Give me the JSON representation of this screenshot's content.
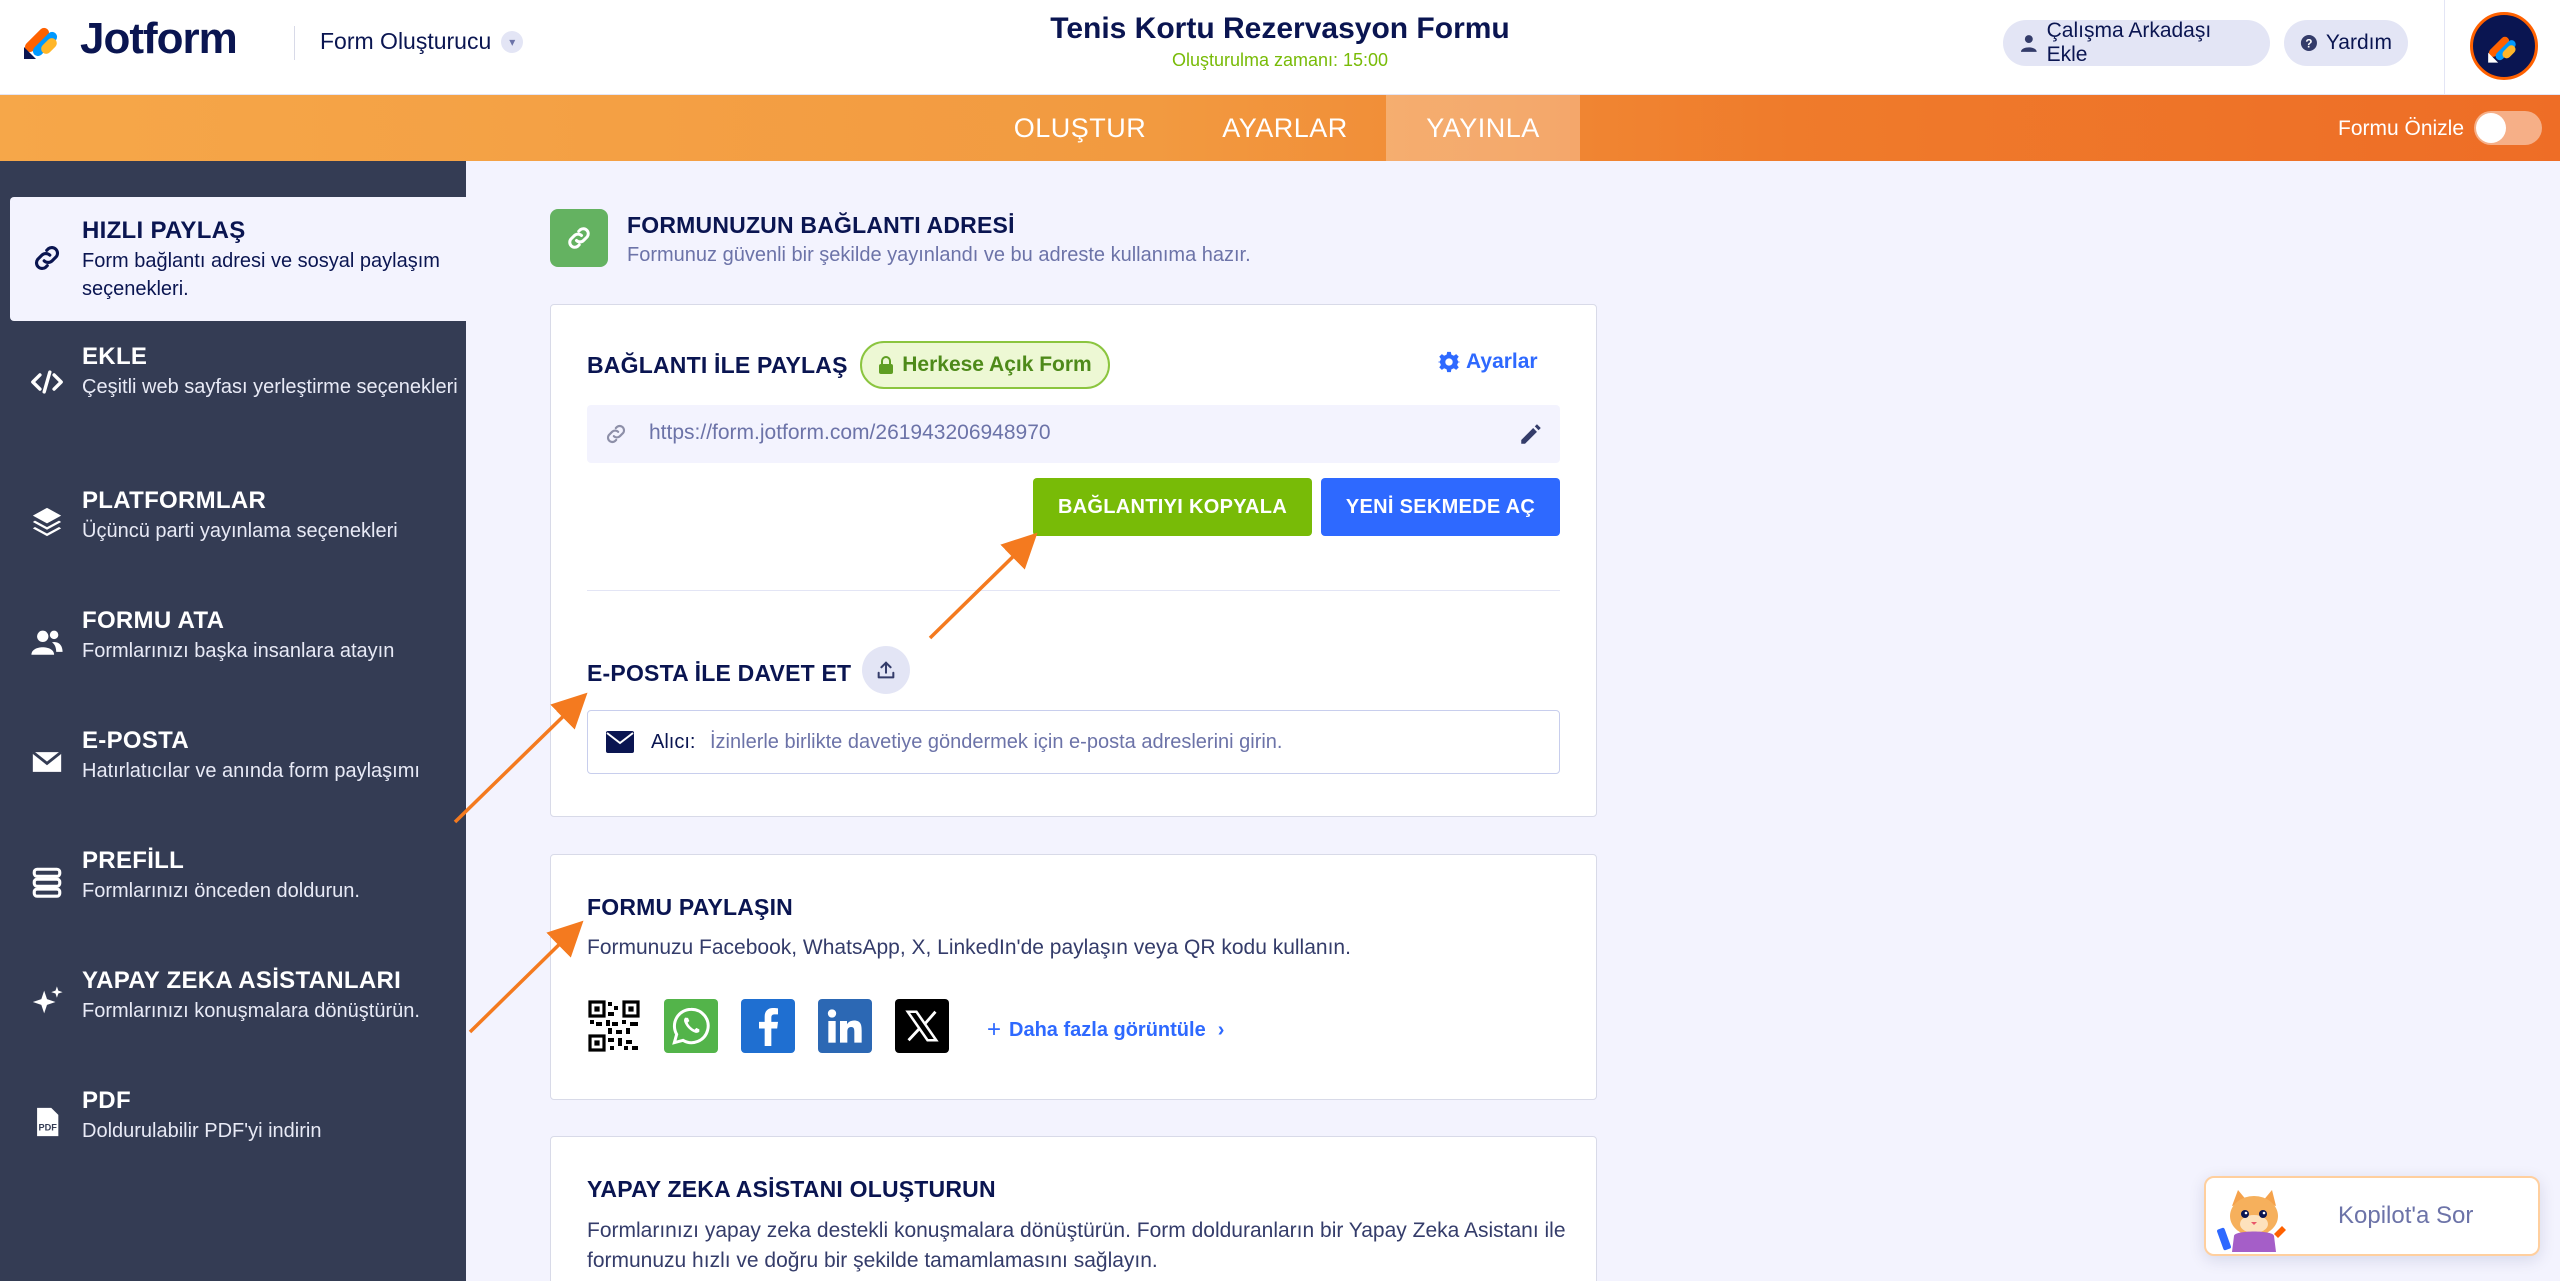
{
  "header": {
    "logo_text": "Jotform",
    "builder_label": "Form Oluşturucu",
    "form_title": "Tenis Kortu Rezervasyon Formu",
    "created_at": "Oluşturulma zamanı: 15:00",
    "add_teammate": "Çalışma Arkadaşı Ekle",
    "help": "Yardım"
  },
  "nav": {
    "tabs": [
      {
        "label": "OLUŞTUR",
        "active": false
      },
      {
        "label": "AYARLAR",
        "active": false
      },
      {
        "label": "YAYINLA",
        "active": true
      }
    ],
    "preview_label": "Formu Önizle",
    "preview_on": false
  },
  "sidebar": {
    "items": [
      {
        "title": "HIZLI PAYLAŞ",
        "desc": "Form bağlantı adresi ve sosyal paylaşım seçenekleri.",
        "icon": "link-icon",
        "active": true
      },
      {
        "title": "EKLE",
        "desc": "Çeşitli web sayfası yerleştirme seçenekleri",
        "icon": "code-icon",
        "active": false
      },
      {
        "title": "PLATFORMLAR",
        "desc": "Üçüncü parti yayınlama seçenekleri",
        "icon": "layers-icon",
        "active": false
      },
      {
        "title": "FORMU ATA",
        "desc": "Formlarınızı başka insanlara atayın",
        "icon": "users-icon",
        "active": false
      },
      {
        "title": "E-POSTA",
        "desc": "Hatırlatıcılar ve anında form paylaşımı",
        "icon": "envelope-icon",
        "active": false
      },
      {
        "title": "PREFİLL",
        "desc": "Formlarınızı önceden doldurun.",
        "icon": "prefill-icon",
        "active": false
      },
      {
        "title": "YAPAY ZEKA ASİSTANLARI",
        "desc": "Formlarınızı konuşmalara dönüştürün.",
        "icon": "sparkle-icon",
        "active": false
      },
      {
        "title": "PDF",
        "desc": "Doldurulabilir PDF'yi indirin",
        "icon": "pdf-icon",
        "active": false
      }
    ]
  },
  "link_section": {
    "title": "FORMUNUZUN BAĞLANTI ADRESİ",
    "desc": "Formunuz güvenli bir şekilde yayınlandı ve bu adreste kullanıma hazır."
  },
  "share_link": {
    "title": "BAĞLANTI İLE PAYLAŞ",
    "badge": "Herkese Açık Form",
    "settings": "Ayarlar",
    "url": "https://form.jotform.com/261943206948970",
    "copy_button": "BAĞLANTIYI KOPYALA",
    "open_button": "YENİ SEKMEDE AÇ"
  },
  "email_invite": {
    "title": "E-POSTA İLE DAVET ET",
    "label": "Alıcı:",
    "placeholder": "İzinlerle birlikte davetiye göndermek için e-posta adreslerini girin."
  },
  "share_form": {
    "title": "FORMU PAYLAŞIN",
    "desc": "Formunuzu Facebook, WhatsApp, X, LinkedIn'de paylaşın veya QR kodu kullanın.",
    "more": "Daha fazla görüntüle",
    "icons": [
      "qr-code-icon",
      "whatsapp-icon",
      "facebook-icon",
      "linkedin-icon",
      "x-icon"
    ]
  },
  "ai_section": {
    "title": "YAPAY ZEKA ASİSTANI OLUŞTURUN",
    "desc": "Formlarınızı yapay zeka destekli konuşmalara dönüştürün. Form dolduranların bir Yapay Zeka Asistanı ile formunuzu hızlı ve doğru bir şekilde tamamlamasını sağlayın."
  },
  "kopilot": {
    "label": "Kopilot'a Sor"
  },
  "colors": {
    "navy": "#0a1551",
    "orange": "#ff6100",
    "green": "#78bb07",
    "blue": "#2e69ff",
    "sidebar": "#343c54"
  }
}
